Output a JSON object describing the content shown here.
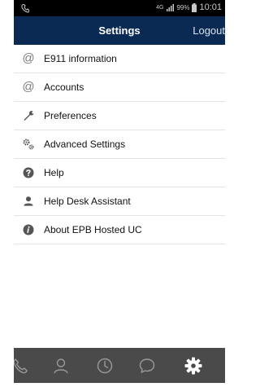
{
  "status": {
    "network": "4G",
    "battery": "99%",
    "time": "10:01"
  },
  "header": {
    "title": "Settings",
    "logout": "Logout"
  },
  "menu": [
    {
      "label": "E911 information",
      "icon": "at-icon"
    },
    {
      "label": "Accounts",
      "icon": "at-icon"
    },
    {
      "label": "Preferences",
      "icon": "wrench-icon"
    },
    {
      "label": "Advanced Settings",
      "icon": "gears-icon"
    },
    {
      "label": "Help",
      "icon": "question-icon"
    },
    {
      "label": "Help Desk Assistant",
      "icon": "user-icon"
    },
    {
      "label": "About EPB Hosted UC",
      "icon": "info-icon"
    }
  ],
  "tabs": [
    "phone-icon",
    "contacts-icon",
    "history-icon",
    "chat-icon",
    "settings-gear-icon"
  ],
  "colors": {
    "header": "#0a2a53",
    "tabbar": "#4a4a4a",
    "active_tab": "#ffffff",
    "inactive_tab": "#9a9a9a"
  }
}
